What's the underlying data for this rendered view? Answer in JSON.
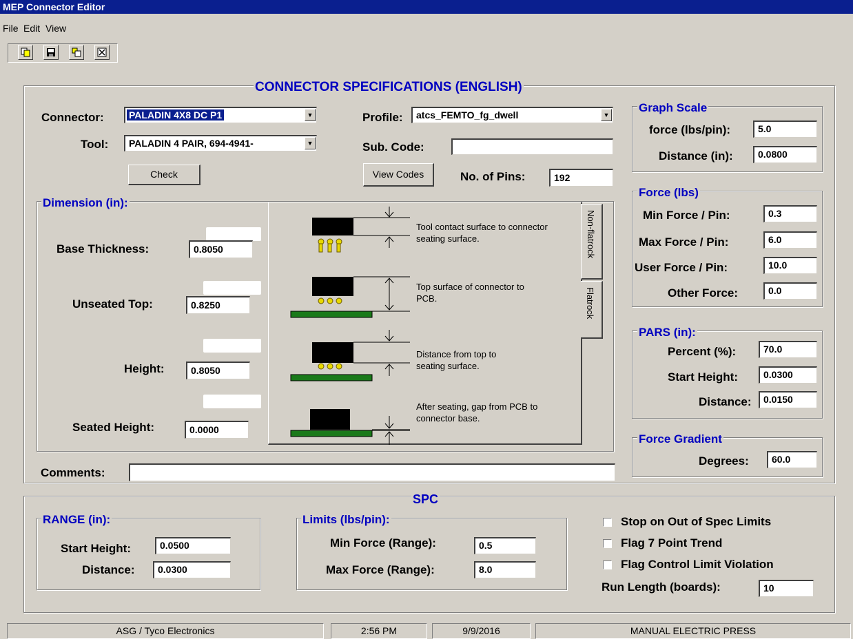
{
  "window": {
    "title": "MEP Connector Editor"
  },
  "menu": [
    "File",
    "Edit",
    "View"
  ],
  "toolbar": [
    {
      "name": "copy-icon",
      "glyph": "⎘"
    },
    {
      "name": "save-icon",
      "glyph": "▣"
    },
    {
      "name": "paste-icon",
      "glyph": "⧉"
    },
    {
      "name": "close-icon",
      "glyph": "✕"
    }
  ],
  "main": {
    "title": "CONNECTOR SPECIFICATIONS (ENGLISH)",
    "connector_label": "Connector:",
    "connector_value": "PALADIN 4X8 DC P1",
    "tool_label": "Tool:",
    "tool_value": "PALADIN 4 PAIR, 694-4941-",
    "check_button": "Check",
    "profile_label": "Profile:",
    "profile_value": "atcs_FEMTO_fg_dwell",
    "subcode_label": "Sub. Code:",
    "subcode_value": "",
    "view_codes_button": "View Codes",
    "pins_label": "No. of Pins:",
    "pins_value": "192",
    "comments_label": "Comments:",
    "comments_value": ""
  },
  "dimension": {
    "title": "Dimension (in):",
    "base_thickness_label": "Base Thickness:",
    "base_thickness_value": "0.8050",
    "unseated_top_label": "Unseated Top:",
    "unseated_top_value": "0.8250",
    "height_label": "Height:",
    "height_value": "0.8050",
    "seated_height_label": "Seated Height:",
    "seated_height_value": "0.0000",
    "diagram": {
      "text1": "Tool contact surface to connector seating surface.",
      "text2": "Top surface of connector to PCB.",
      "text3": "Distance from top to seating surface.",
      "text4": "After seating, gap from PCB to connector base."
    },
    "tabs": {
      "nonflatrock": "Non-flatrock",
      "flatrock": "Flatrock"
    }
  },
  "graph_scale": {
    "title": "Graph Scale",
    "force_label": "force (lbs/pin):",
    "force_value": "5.0",
    "distance_label": "Distance (in):",
    "distance_value": "0.0800"
  },
  "force": {
    "title": "Force (lbs)",
    "min_label": "Min Force / Pin:",
    "min_value": "0.3",
    "max_label": "Max Force / Pin:",
    "max_value": "6.0",
    "user_label": "User Force / Pin:",
    "user_value": "10.0",
    "other_label": "Other Force:",
    "other_value": "0.0"
  },
  "pars": {
    "title": "PARS (in):",
    "percent_label": "Percent (%):",
    "percent_value": "70.0",
    "start_label": "Start Height:",
    "start_value": "0.0300",
    "distance_label": "Distance:",
    "distance_value": "0.0150"
  },
  "gradient": {
    "title": "Force Gradient",
    "degrees_label": "Degrees:",
    "degrees_value": "60.0"
  },
  "spc": {
    "title": "SPC",
    "range_title": "RANGE (in):",
    "range_start_label": "Start Height:",
    "range_start_value": "0.0500",
    "range_distance_label": "Distance:",
    "range_distance_value": "0.0300",
    "limits_title": "Limits (lbs/pin):",
    "min_force_label": "Min Force (Range):",
    "min_force_value": "0.5",
    "max_force_label": "Max Force (Range):",
    "max_force_value": "8.0",
    "stop_label": "Stop on Out of Spec Limits",
    "flag7_label": "Flag 7 Point Trend",
    "flagctl_label": "Flag Control Limit Violation",
    "runlength_label": "Run Length (boards):",
    "runlength_value": "10"
  },
  "status": {
    "company": "ASG / Tyco Electronics",
    "time": "2:56 PM",
    "date": "9/9/2016",
    "mode": "MANUAL ELECTRIC PRESS"
  },
  "colors": {
    "title_bar": "#0a1f8f",
    "group_title": "#0000c0",
    "pcb": "#1a7a1a",
    "connector": "#000000",
    "pins": "#e8d800"
  }
}
